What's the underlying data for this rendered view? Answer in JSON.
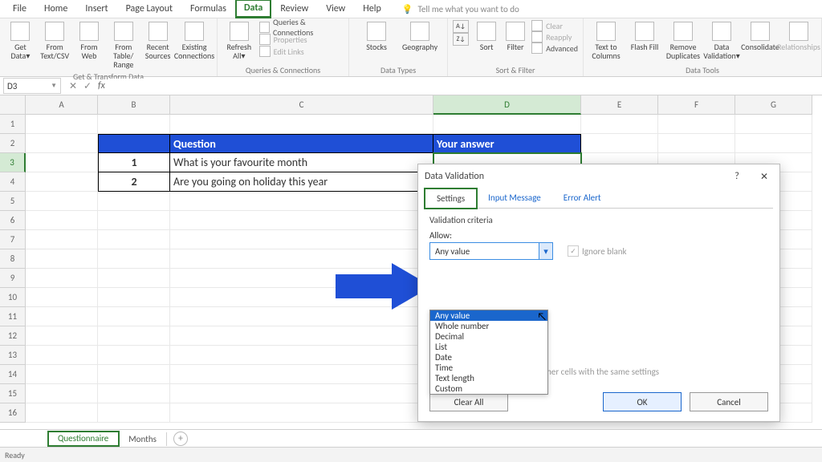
{
  "menubar": {
    "tabs": [
      "File",
      "Home",
      "Insert",
      "Page Layout",
      "Formulas",
      "Data",
      "Review",
      "View",
      "Help"
    ],
    "active_index": 5,
    "tell": "Tell me what you want to do"
  },
  "ribbon": {
    "groups": [
      {
        "label": "Get & Transform Data",
        "buttons": [
          {
            "label": "Get\nData▾",
            "name": "get-data"
          },
          {
            "label": "From\nText/CSV",
            "name": "from-text-csv"
          },
          {
            "label": "From\nWeb",
            "name": "from-web"
          },
          {
            "label": "From Table/\nRange",
            "name": "from-table-range"
          },
          {
            "label": "Recent\nSources",
            "name": "recent-sources"
          },
          {
            "label": "Existing\nConnections",
            "name": "existing-connections"
          }
        ]
      },
      {
        "label": "Queries & Connections",
        "main": {
          "label": "Refresh\nAll▾",
          "name": "refresh-all"
        },
        "minis": [
          {
            "label": "Queries & Connections",
            "name": "queries-connections"
          },
          {
            "label": "Properties",
            "name": "properties"
          },
          {
            "label": "Edit Links",
            "name": "edit-links"
          }
        ]
      },
      {
        "label": "Data Types",
        "buttons": [
          {
            "label": "Stocks",
            "name": "stocks"
          },
          {
            "label": "Geography",
            "name": "geography"
          }
        ]
      },
      {
        "label": "Sort & Filter",
        "buttons": [
          {
            "label": "Sort",
            "name": "sort"
          },
          {
            "label": "Filter",
            "name": "filter"
          }
        ],
        "minis": [
          {
            "label": "Clear",
            "name": "clear"
          },
          {
            "label": "Reapply",
            "name": "reapply"
          },
          {
            "label": "Advanced",
            "name": "advanced"
          }
        ]
      },
      {
        "label": "Data Tools",
        "buttons": [
          {
            "label": "Text to\nColumns",
            "name": "text-to-columns"
          },
          {
            "label": "Flash\nFill",
            "name": "flash-fill"
          },
          {
            "label": "Remove\nDuplicates",
            "name": "remove-duplicates"
          },
          {
            "label": "Data\nValidation▾",
            "name": "data-validation"
          },
          {
            "label": "Consolidate",
            "name": "consolidate"
          },
          {
            "label": "Relationships",
            "name": "relationships"
          }
        ]
      }
    ]
  },
  "namebox": "D3",
  "formula": "",
  "columns": [
    "A",
    "B",
    "C",
    "D",
    "E",
    "F",
    "G"
  ],
  "rows_count": 16,
  "sheet": {
    "headers": {
      "B": "",
      "C": "Question",
      "D": "Your answer"
    },
    "data": [
      {
        "num": "1",
        "q": "What is your favourite month"
      },
      {
        "num": "2",
        "q": "Are you going on holiday this year"
      }
    ]
  },
  "dialog": {
    "title": "Data Validation",
    "tabs": [
      "Settings",
      "Input Message",
      "Error Alert"
    ],
    "active_tab": 0,
    "criteria_label": "Validation criteria",
    "allow_label": "Allow:",
    "allow_value": "Any value",
    "ignore_label": "Ignore blank",
    "options": [
      "Any value",
      "Whole number",
      "Decimal",
      "List",
      "Date",
      "Time",
      "Text length",
      "Custom"
    ],
    "selected_option_index": 0,
    "apply_label": "Apply these changes to all other cells with the same settings",
    "buttons": {
      "clear": "Clear All",
      "ok": "OK",
      "cancel": "Cancel"
    },
    "help_icon": "?",
    "close_icon": "✕"
  },
  "sheets": {
    "tabs": [
      "Questionnaire",
      "Months"
    ],
    "active": 0
  },
  "status": "Ready"
}
